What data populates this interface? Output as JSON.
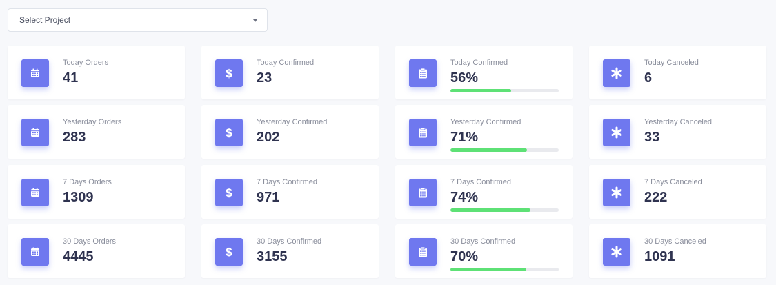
{
  "project_select": {
    "label": "Select Project"
  },
  "colors": {
    "icon_bg": "#6f78ef",
    "progress": "#5ee176",
    "track": "#e9eaee"
  },
  "rows": [
    [
      {
        "icon": "calendar-icon",
        "label": "Today Orders",
        "value": "41"
      },
      {
        "icon": "dollar-icon",
        "label": "Today Confirmed",
        "value": "23"
      },
      {
        "icon": "clipboard-icon",
        "label": "Today Confirmed",
        "value": "56%",
        "progress": 0.56
      },
      {
        "icon": "asterisk-icon",
        "label": "Today Canceled",
        "value": "6"
      }
    ],
    [
      {
        "icon": "calendar-icon",
        "label": "Yesterday Orders",
        "value": "283"
      },
      {
        "icon": "dollar-icon",
        "label": "Yesterday Confirmed",
        "value": "202"
      },
      {
        "icon": "clipboard-icon",
        "label": "Yesterday Confirmed",
        "value": "71%",
        "progress": 0.71
      },
      {
        "icon": "asterisk-icon",
        "label": "Yesterday Canceled",
        "value": "33"
      }
    ],
    [
      {
        "icon": "calendar-icon",
        "label": "7 Days Orders",
        "value": "1309"
      },
      {
        "icon": "dollar-icon",
        "label": "7 Days Confirmed",
        "value": "971"
      },
      {
        "icon": "clipboard-icon",
        "label": "7 Days Confirmed",
        "value": "74%",
        "progress": 0.74
      },
      {
        "icon": "asterisk-icon",
        "label": "7 Days Canceled",
        "value": "222"
      }
    ],
    [
      {
        "icon": "calendar-icon",
        "label": "30 Days Orders",
        "value": "4445"
      },
      {
        "icon": "dollar-icon",
        "label": "30 Days Confirmed",
        "value": "3155"
      },
      {
        "icon": "clipboard-icon",
        "label": "30 Days Confirmed",
        "value": "70%",
        "progress": 0.7
      },
      {
        "icon": "asterisk-icon",
        "label": "30 Days Canceled",
        "value": "1091"
      }
    ]
  ]
}
